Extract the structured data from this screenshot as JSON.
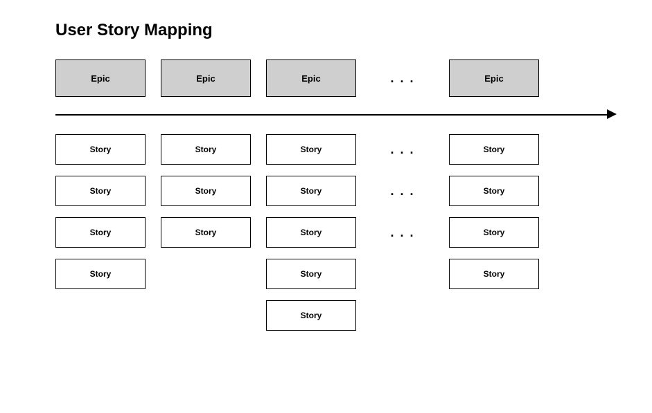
{
  "title": "User Story Mapping",
  "ellipsis": ". . .",
  "columns": [
    {
      "epic": "Epic",
      "stories": [
        "Story",
        "Story",
        "Story",
        "Story"
      ]
    },
    {
      "epic": "Epic",
      "stories": [
        "Story",
        "Story",
        "Story"
      ]
    },
    {
      "epic": "Epic",
      "stories": [
        "Story",
        "Story",
        "Story",
        "Story",
        "Story"
      ]
    },
    {
      "epic": "Epic",
      "stories": [
        "Story",
        "Story",
        "Story",
        "Story"
      ]
    }
  ],
  "ellipsis_story_rows": [
    true,
    true,
    true,
    false,
    false
  ]
}
